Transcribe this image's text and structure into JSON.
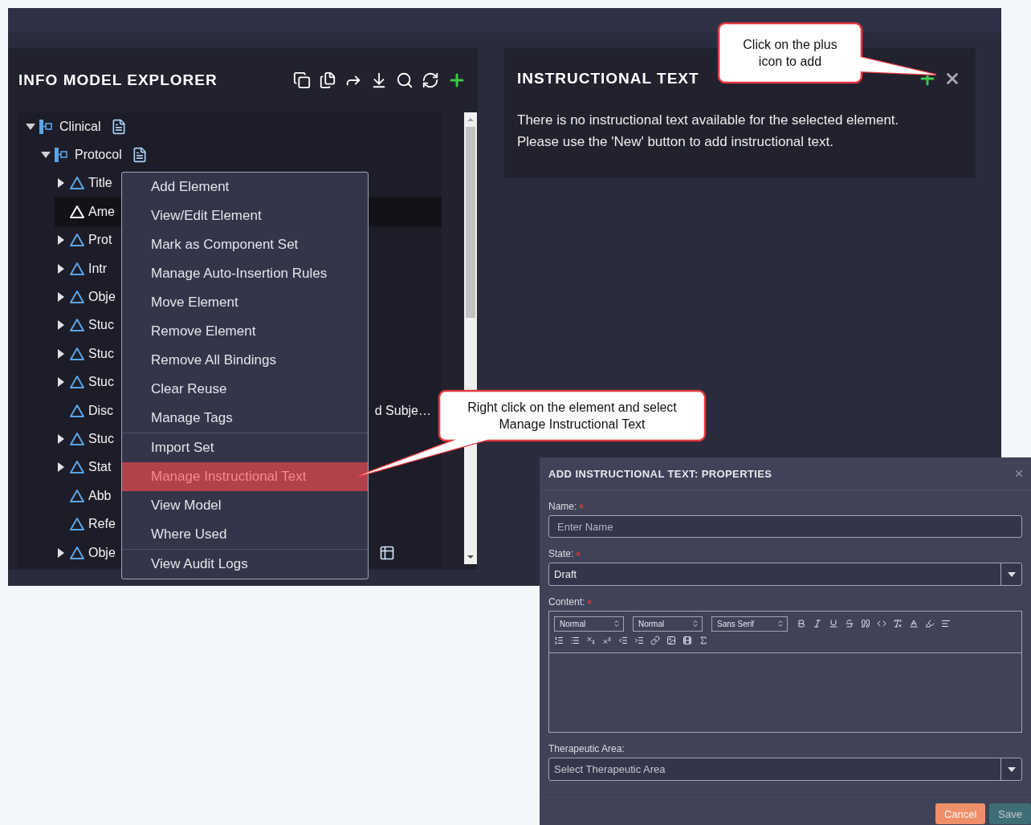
{
  "explorer": {
    "title": "INFO MODEL EXPLORER",
    "tree": [
      {
        "label": "Clinical",
        "kind": "group",
        "expanded": true,
        "selected": false,
        "children": [
          {
            "label": "Protocol",
            "kind": "group",
            "expanded": true,
            "selected": false,
            "children": [
              {
                "label": "Title",
                "kind": "branch",
                "selected": false
              },
              {
                "label": "Ame",
                "kind": "leaf",
                "selected": true
              },
              {
                "label": "Prot",
                "kind": "branch",
                "selected": false
              },
              {
                "label": "Intr",
                "kind": "branch",
                "selected": false
              },
              {
                "label": "Obje",
                "kind": "branch",
                "selected": false
              },
              {
                "label": "Stuc",
                "kind": "branch",
                "selected": false
              },
              {
                "label": "Stuc",
                "kind": "branch",
                "selected": false
              },
              {
                "label": "Stuc",
                "kind": "branch",
                "selected": false
              },
              {
                "label": "Disc",
                "kind": "leaf",
                "selected": false,
                "tail": "d Subje…"
              },
              {
                "label": "Stuc",
                "kind": "branch",
                "selected": false
              },
              {
                "label": "Stat",
                "kind": "branch",
                "selected": false
              },
              {
                "label": "Abb",
                "kind": "leaf",
                "selected": false
              },
              {
                "label": "Refe",
                "kind": "leaf",
                "selected": false
              },
              {
                "label": "Obje",
                "kind": "branch",
                "selected": false,
                "has_table": true
              }
            ]
          }
        ]
      }
    ]
  },
  "context_menu": {
    "groups": [
      [
        {
          "label": "Add Element",
          "selected": false
        },
        {
          "label": "View/Edit Element",
          "selected": false
        },
        {
          "label": "Mark as Component Set",
          "selected": false
        },
        {
          "label": "Manage Auto-Insertion Rules",
          "selected": false
        },
        {
          "label": "Move Element",
          "selected": false
        },
        {
          "label": "Remove Element",
          "selected": false
        },
        {
          "label": "Remove All Bindings",
          "selected": false
        },
        {
          "label": "Clear Reuse",
          "selected": false
        },
        {
          "label": "Manage Tags",
          "selected": false
        }
      ],
      [
        {
          "label": "Import Set",
          "selected": false
        },
        {
          "label": "Manage Instructional Text",
          "selected": true
        },
        {
          "label": "View Model",
          "selected": false
        },
        {
          "label": "Where Used",
          "selected": false
        }
      ],
      [
        {
          "label": "View Audit Logs",
          "selected": false
        }
      ]
    ]
  },
  "instructional_panel": {
    "title": "INSTRUCTIONAL TEXT",
    "message": "There is no instructional text available for the selected element. Please use the 'New' button to add instructional text."
  },
  "dialog": {
    "title": "ADD INSTRUCTIONAL TEXT: PROPERTIES",
    "fields": [
      {
        "kind": "text",
        "label": "Name:",
        "required": true,
        "placeholder": "Enter Name"
      },
      {
        "kind": "select",
        "label": "State:",
        "required": true,
        "value": "Draft"
      },
      {
        "kind": "editor",
        "label": "Content:",
        "required": true,
        "toolbar_selects": [
          "Normal",
          "Normal",
          "Sans Serif"
        ]
      },
      {
        "kind": "select",
        "label": "Therapeutic Area:",
        "required": false,
        "placeholder": "Select Therapeutic Area"
      }
    ],
    "buttons": [
      {
        "label": "Cancel",
        "kind": "secondary"
      },
      {
        "label": "Save",
        "kind": "primary"
      }
    ]
  },
  "callouts": [
    {
      "text": "Click on the plus icon to add"
    },
    {
      "text": "Right click on the element and select Manage Instructional Text"
    }
  ]
}
